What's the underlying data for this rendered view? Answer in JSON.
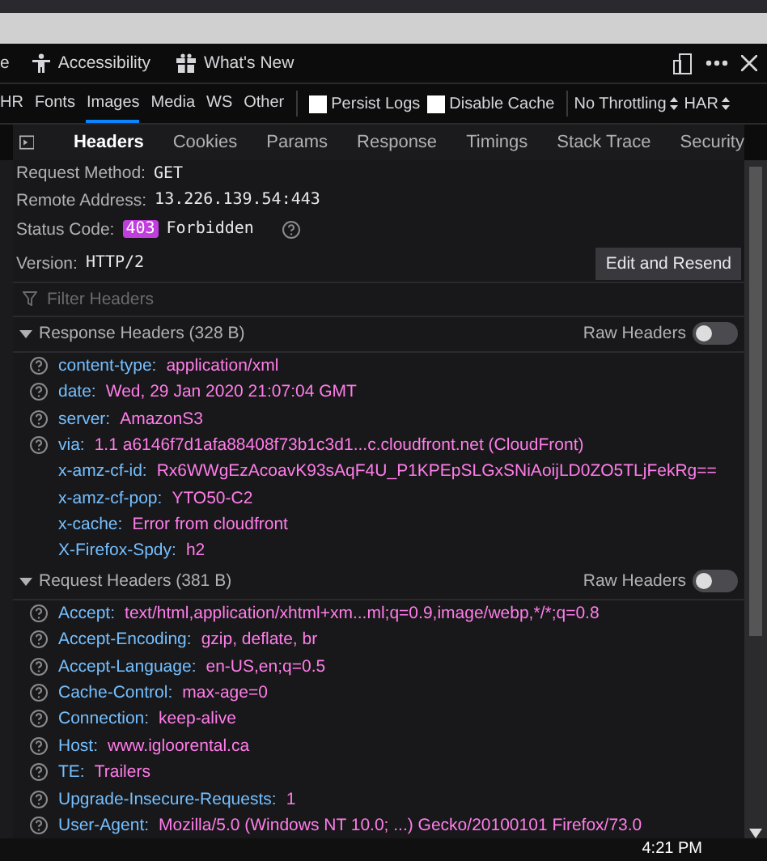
{
  "toolbar": {
    "tools": [
      {
        "label": "e"
      },
      {
        "label": "Accessibility"
      },
      {
        "label": "What's New"
      }
    ]
  },
  "filters": [
    {
      "label": "HR",
      "selected": false
    },
    {
      "label": "Fonts",
      "selected": false
    },
    {
      "label": "Images",
      "selected": true
    },
    {
      "label": "Media",
      "selected": false
    },
    {
      "label": "WS",
      "selected": false
    },
    {
      "label": "Other",
      "selected": false
    }
  ],
  "options": [
    {
      "label": "Persist Logs",
      "checked": false
    },
    {
      "label": "Disable Cache",
      "checked": false
    }
  ],
  "selects": [
    "No Throttling",
    "HAR"
  ],
  "tabs": [
    {
      "label": "Headers",
      "selected": true
    },
    {
      "label": "Cookies",
      "selected": false
    },
    {
      "label": "Params",
      "selected": false
    },
    {
      "label": "Response",
      "selected": false
    },
    {
      "label": "Timings",
      "selected": false
    },
    {
      "label": "Stack Trace",
      "selected": false
    },
    {
      "label": "Security",
      "selected": false
    }
  ],
  "summary": {
    "method_label": "Request Method:",
    "method": "GET",
    "address_label": "Remote Address:",
    "address": "13.226.139.54:443",
    "status_label": "Status Code:",
    "status_code": "403",
    "status_text": "Forbidden",
    "version_label": "Version:",
    "version": "HTTP/2",
    "resend_button": "Edit and Resend"
  },
  "filter_placeholder": "Filter Headers",
  "sections": [
    {
      "title": "Response Headers (328 B)",
      "expanded": true,
      "raw_label": "Raw Headers",
      "raw_on": false,
      "headers": [
        {
          "name": "content-type:",
          "value": "application/xml",
          "help": true
        },
        {
          "name": "date:",
          "value": "Wed, 29 Jan 2020 21:07:04 GMT",
          "help": true
        },
        {
          "name": "server:",
          "value": "AmazonS3",
          "help": true
        },
        {
          "name": "via:",
          "value": "1.1 a6146f7d1afa88408f73b1c3d1...c.cloudfront.net (CloudFront)",
          "help": true
        },
        {
          "name": "x-amz-cf-id:",
          "value": "Rx6WWgEzAcoavK93sAqF4U_P1KPEpSLGxSNiAoijLD0ZO5TLjFekRg==",
          "help": false
        },
        {
          "name": "x-amz-cf-pop:",
          "value": "YTO50-C2",
          "help": false
        },
        {
          "name": "x-cache:",
          "value": "Error from cloudfront",
          "help": false
        },
        {
          "name": "X-Firefox-Spdy:",
          "value": "h2",
          "help": false
        }
      ]
    },
    {
      "title": "Request Headers (381 B)",
      "expanded": true,
      "raw_label": "Raw Headers",
      "raw_on": false,
      "headers": [
        {
          "name": "Accept:",
          "value": "text/html,application/xhtml+xm...ml;q=0.9,image/webp,*/*;q=0.8",
          "help": true
        },
        {
          "name": "Accept-Encoding:",
          "value": "gzip, deflate, br",
          "help": true
        },
        {
          "name": "Accept-Language:",
          "value": "en-US,en;q=0.5",
          "help": true
        },
        {
          "name": "Cache-Control:",
          "value": "max-age=0",
          "help": true
        },
        {
          "name": "Connection:",
          "value": "keep-alive",
          "help": true
        },
        {
          "name": "Host:",
          "value": "www.igloorental.ca",
          "help": true
        },
        {
          "name": "TE:",
          "value": "Trailers",
          "help": true
        },
        {
          "name": "Upgrade-Insecure-Requests:",
          "value": "1",
          "help": true
        },
        {
          "name": "User-Agent:",
          "value": "Mozilla/5.0 (Windows NT 10.0; ...) Gecko/20100101 Firefox/73.0",
          "help": true
        }
      ]
    }
  ],
  "taskbar": {
    "time": "4:21 PM"
  }
}
